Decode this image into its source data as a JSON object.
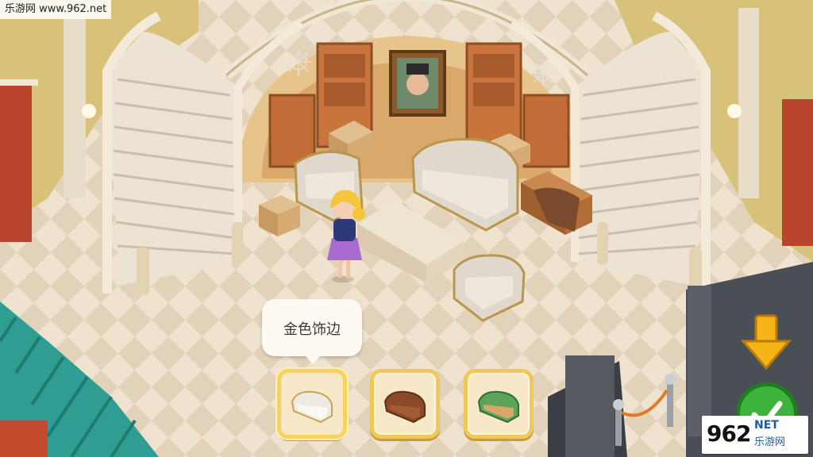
{
  "watermark": {
    "top_left": "乐游网 www.962.net",
    "bottom_right_number": "962",
    "bottom_right_net": "NET",
    "bottom_right_cn": "乐游网"
  },
  "tooltip": {
    "label": "金色饰边"
  },
  "options": [
    {
      "icon": "white-gold-sofa-icon",
      "selected": true
    },
    {
      "icon": "brown-leather-sofa-icon",
      "selected": false
    },
    {
      "icon": "green-floral-sofa-icon",
      "selected": false
    }
  ],
  "colors": {
    "selection_border": "#f0c75a",
    "confirm_green": "#3cb43c",
    "arrow_yellow": "#f6b418",
    "floor_light": "#efe3cf",
    "floor_dark": "#e1d1b8"
  }
}
